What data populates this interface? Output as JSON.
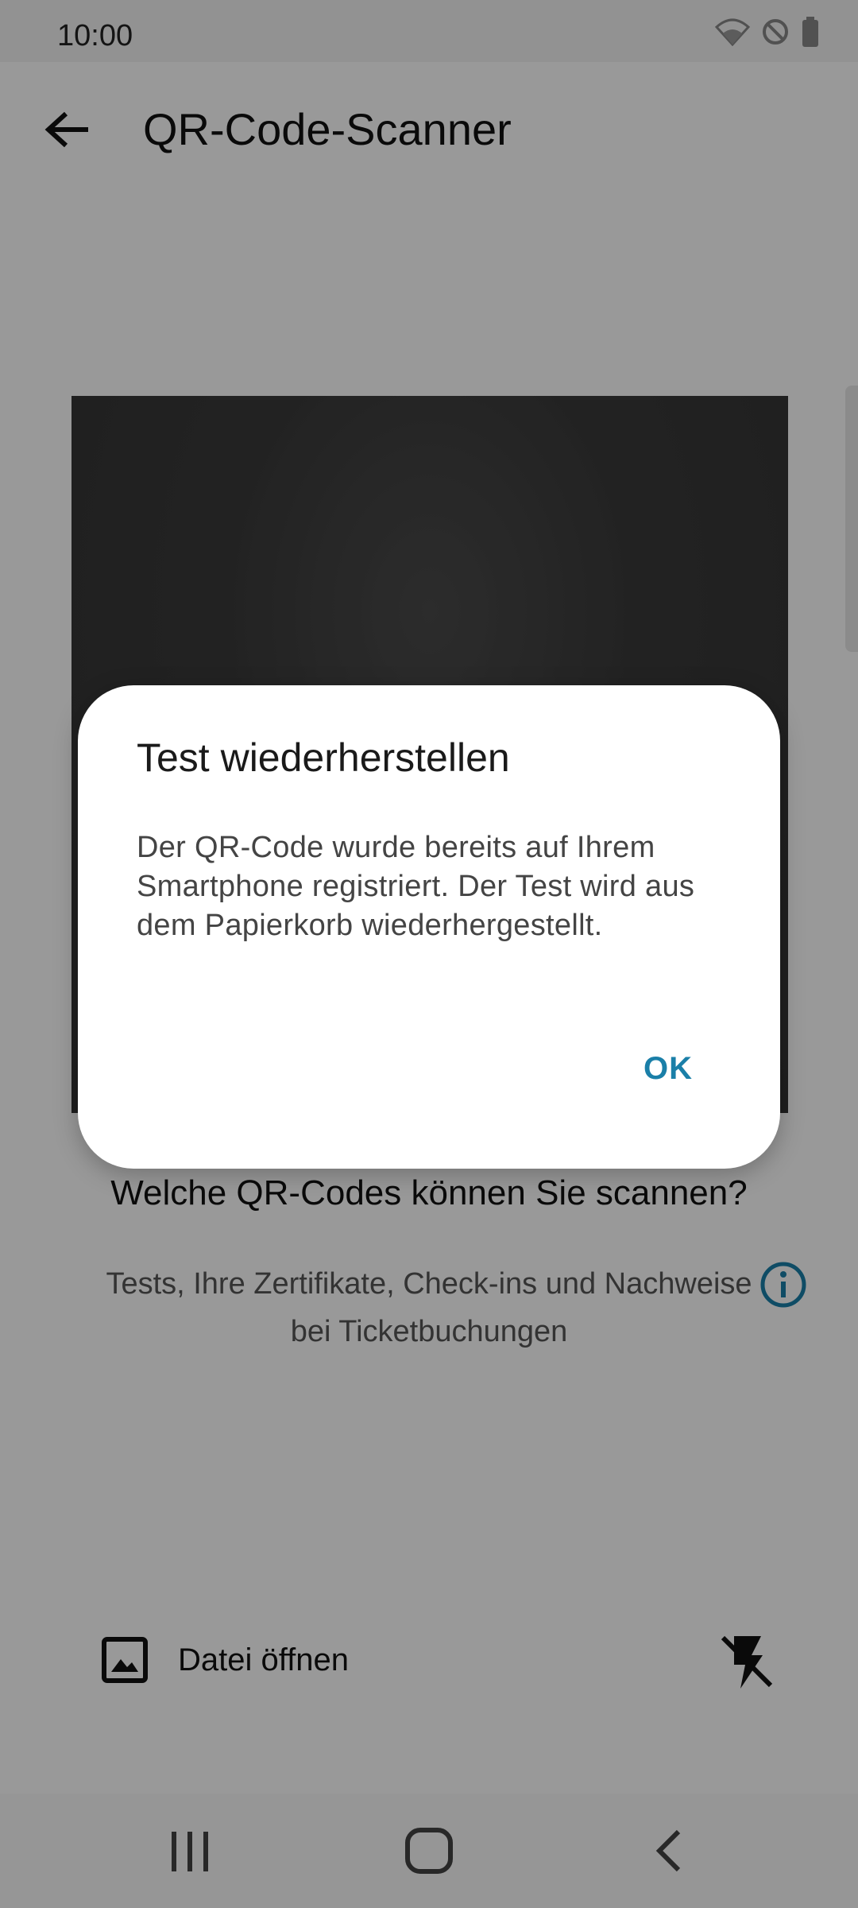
{
  "status_bar": {
    "time": "10:00",
    "icons": [
      "wifi-icon",
      "do-not-disturb-icon",
      "battery-icon"
    ]
  },
  "app_bar": {
    "title": "QR-Code-Scanner",
    "back_icon": "arrow-back-icon"
  },
  "info": {
    "title": "Welche QR-Codes können Sie scannen?",
    "text": "Tests, Ihre Zertifikate, Check-ins und Nachweise bei Ticketbuchungen",
    "icon": "info-icon"
  },
  "actions": {
    "open_file_label": "Datei öffnen",
    "open_file_icon": "image-icon",
    "flash_icon": "flash-off-icon"
  },
  "dialog": {
    "title": "Test wiederherstellen",
    "body": "Der QR-Code wurde bereits auf Ihrem Smartphone registriert. Der Test wird aus dem Papierkorb wiederhergestellt.",
    "ok_label": "OK"
  },
  "nav_bar": {
    "icons": [
      "recent-apps-icon",
      "home-icon",
      "back-icon"
    ]
  },
  "colors": {
    "accent": "#1a7fa8",
    "scrim": "rgba(0,0,0,0.40)",
    "camera_background": "#3a3a3a"
  }
}
